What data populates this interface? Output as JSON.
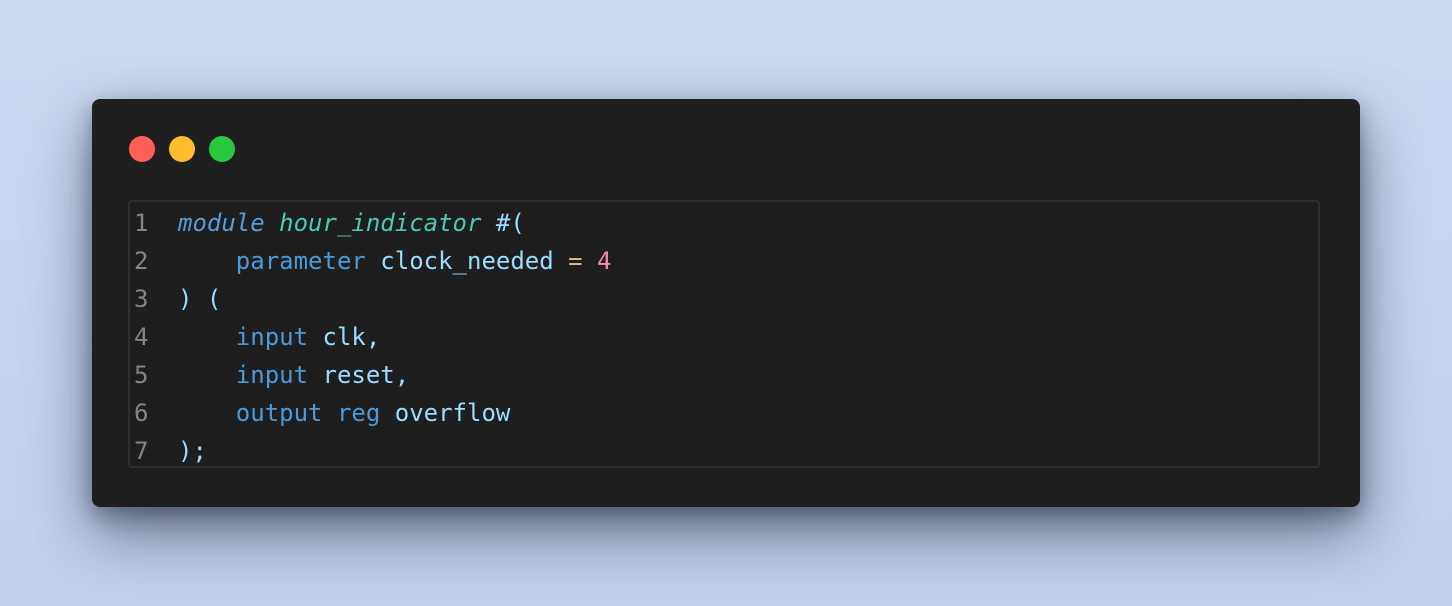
{
  "window": {
    "title_buttons": [
      {
        "name": "close",
        "color": "#ff5f57"
      },
      {
        "name": "minimize",
        "color": "#febc2e"
      },
      {
        "name": "maximize",
        "color": "#28c840"
      }
    ]
  },
  "colors": {
    "keyword_storage": "#569cd6",
    "keyword": "#4b9ad8",
    "module_name": "#4ec9b0",
    "identifier": "#9cdcfe",
    "punctuation": "#9cdcfe",
    "operator": "#d7ba7d",
    "number": "#f48ca4",
    "line_number": "#858585"
  },
  "code": {
    "lines": [
      {
        "number": "1",
        "tokens": [
          {
            "text": "module",
            "kind": "keyword_storage",
            "italic": true
          },
          {
            "text": " ",
            "kind": "identifier"
          },
          {
            "text": "hour_indicator",
            "kind": "module_name",
            "italic": true
          },
          {
            "text": " #(",
            "kind": "punctuation"
          }
        ]
      },
      {
        "number": "2",
        "tokens": [
          {
            "text": "    ",
            "kind": "identifier"
          },
          {
            "text": "parameter",
            "kind": "keyword"
          },
          {
            "text": " clock_needed ",
            "kind": "identifier"
          },
          {
            "text": "=",
            "kind": "operator"
          },
          {
            "text": " ",
            "kind": "identifier"
          },
          {
            "text": "4",
            "kind": "number"
          }
        ]
      },
      {
        "number": "3",
        "tokens": [
          {
            "text": ") (",
            "kind": "punctuation"
          }
        ]
      },
      {
        "number": "4",
        "tokens": [
          {
            "text": "    ",
            "kind": "identifier"
          },
          {
            "text": "input",
            "kind": "keyword"
          },
          {
            "text": " clk,",
            "kind": "identifier"
          }
        ]
      },
      {
        "number": "5",
        "tokens": [
          {
            "text": "    ",
            "kind": "identifier"
          },
          {
            "text": "input",
            "kind": "keyword"
          },
          {
            "text": " reset,",
            "kind": "identifier"
          }
        ]
      },
      {
        "number": "6",
        "tokens": [
          {
            "text": "    ",
            "kind": "identifier"
          },
          {
            "text": "output",
            "kind": "keyword"
          },
          {
            "text": " ",
            "kind": "identifier"
          },
          {
            "text": "reg",
            "kind": "keyword"
          },
          {
            "text": " overflow",
            "kind": "identifier"
          }
        ]
      },
      {
        "number": "7",
        "tokens": [
          {
            "text": ");",
            "kind": "punctuation"
          }
        ]
      }
    ]
  }
}
